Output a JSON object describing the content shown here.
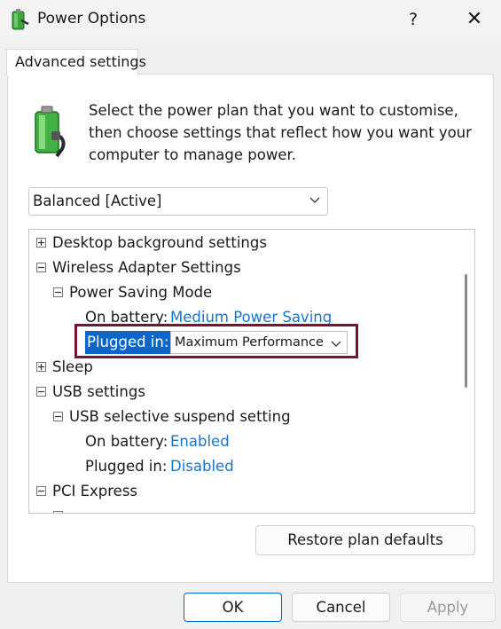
{
  "window": {
    "title": "Power Options",
    "help_glyph": "?",
    "close_glyph": "✕"
  },
  "tab": {
    "label": "Advanced settings"
  },
  "intro_text": "Select the power plan that you want to customise, then choose settings that reflect how you want your computer to manage power.",
  "plan_select": {
    "value": "Balanced [Active]"
  },
  "tree": {
    "rows": [
      {
        "label": "Desktop background settings",
        "state": "collapsed"
      },
      {
        "label": "Wireless Adapter Settings",
        "state": "expanded"
      },
      {
        "label": "Power Saving Mode",
        "state": "expanded"
      },
      {
        "label": "On battery:",
        "value": "Medium Power Saving"
      },
      {
        "label": "Plugged in:",
        "value": "Maximum Performance",
        "selected": true
      },
      {
        "label": "Sleep",
        "state": "collapsed"
      },
      {
        "label": "USB settings",
        "state": "expanded"
      },
      {
        "label": "USB selective suspend setting",
        "state": "expanded"
      },
      {
        "label": "On battery:",
        "value": "Enabled"
      },
      {
        "label": "Plugged in:",
        "value": "Disabled"
      },
      {
        "label": "PCI Express",
        "state": "expanded"
      }
    ]
  },
  "buttons": {
    "restore": "Restore plan defaults",
    "ok": "OK",
    "cancel": "Cancel",
    "apply": "Apply"
  },
  "colors": {
    "accent": "#0a66c8",
    "link_value": "#1a73c8",
    "highlight_frame": "#7a1230"
  }
}
